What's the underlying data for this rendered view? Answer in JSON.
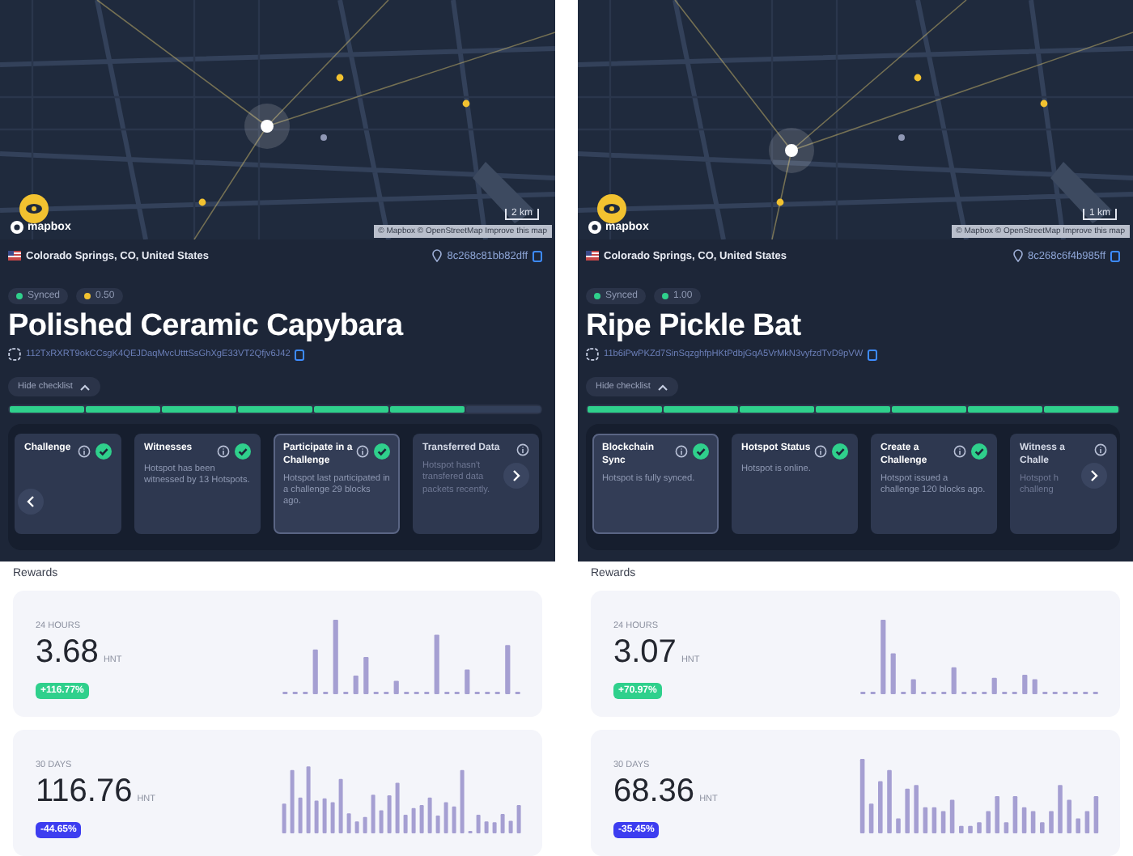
{
  "panels": [
    {
      "map": {
        "logo": "mapbox",
        "scale": "2 km",
        "attribution": "© Mapbox © OpenStreetMap Improve this map"
      },
      "location": "Colorado Springs, CO, United States",
      "hex": "8c268c81bb82dff",
      "badges": [
        {
          "label": "Synced",
          "color": "#2fd08c"
        },
        {
          "label": "0.50",
          "color": "#f2c230"
        }
      ],
      "name": "Polished Ceramic Capybara",
      "address": "112TxRXRT9okCCsgK4QEJDaqMvcUtttSsGhXgE33VT2Qfjv6J42",
      "checklist_toggle": "Hide checklist",
      "progress": [
        {
          "done": true
        },
        {
          "done": true
        },
        {
          "done": true
        },
        {
          "done": true
        },
        {
          "done": true
        },
        {
          "done": true
        },
        {
          "done": false
        }
      ],
      "checklist": [
        {
          "title": "Challenge",
          "done": true,
          "selected": false,
          "cut": true
        },
        {
          "title": "Witnesses",
          "description": "Hotspot has been witnessed by 13 Hotspots.",
          "done": true,
          "selected": false,
          "cut": false
        },
        {
          "title": "Participate in a Challenge",
          "description": "Hotspot last participated in a challenge 29 blocks ago.",
          "done": true,
          "selected": true,
          "cut": false
        },
        {
          "title": "Transferred Data",
          "description": "Hotspot hasn't transfered data packets recently.",
          "done": false,
          "selected": false,
          "cut": false
        }
      ],
      "arrows": {
        "prev": true,
        "next": true
      },
      "rewards": {
        "title": "Rewards",
        "cards": [
          {
            "period": "24 HOURS",
            "amount": "3.68",
            "unit": "HNT",
            "change": "+116.77%",
            "color": "#2fd08c"
          },
          {
            "period": "30 DAYS",
            "amount": "116.76",
            "unit": "HNT",
            "change": "-44.65%",
            "color": "#3d3df0"
          }
        ]
      }
    },
    {
      "map": {
        "logo": "mapbox",
        "scale": "1 km",
        "attribution": "© Mapbox © OpenStreetMap Improve this map"
      },
      "location": "Colorado Springs, CO, United States",
      "hex": "8c268c6f4b985ff",
      "badges": [
        {
          "label": "Synced",
          "color": "#2fd08c"
        },
        {
          "label": "1.00",
          "color": "#2fd08c"
        }
      ],
      "name": "Ripe Pickle Bat",
      "address": "11b6iPwPKZd7SinSqzghfpHKtPdbjGqA5VrMkN3vyfzdTvD9pVW",
      "checklist_toggle": "Hide checklist",
      "progress": [
        {
          "done": true
        },
        {
          "done": true
        },
        {
          "done": true
        },
        {
          "done": true
        },
        {
          "done": true
        },
        {
          "done": true
        },
        {
          "done": true
        }
      ],
      "checklist": [
        {
          "title": "Blockchain Sync",
          "description": "Hotspot is fully synced.",
          "done": true,
          "selected": true,
          "cut": false
        },
        {
          "title": "Hotspot Status",
          "description": "Hotspot is online.",
          "done": true,
          "selected": false,
          "cut": false
        },
        {
          "title": "Create a Challenge",
          "description": "Hotspot issued a challenge 120 blocks ago.",
          "done": true,
          "selected": false,
          "cut": false
        },
        {
          "title": "Witness a Challe",
          "description": "Hotspot h challeng",
          "done": false,
          "selected": false,
          "cut": true
        }
      ],
      "arrows": {
        "prev": false,
        "next": true
      },
      "rewards": {
        "title": "Rewards",
        "cards": [
          {
            "period": "24 HOURS",
            "amount": "3.07",
            "unit": "HNT",
            "change": "+70.97%",
            "color": "#2fd08c"
          },
          {
            "period": "30 DAYS",
            "amount": "68.36",
            "unit": "HNT",
            "change": "-35.45%",
            "color": "#3d3df0"
          }
        ]
      }
    }
  ]
}
